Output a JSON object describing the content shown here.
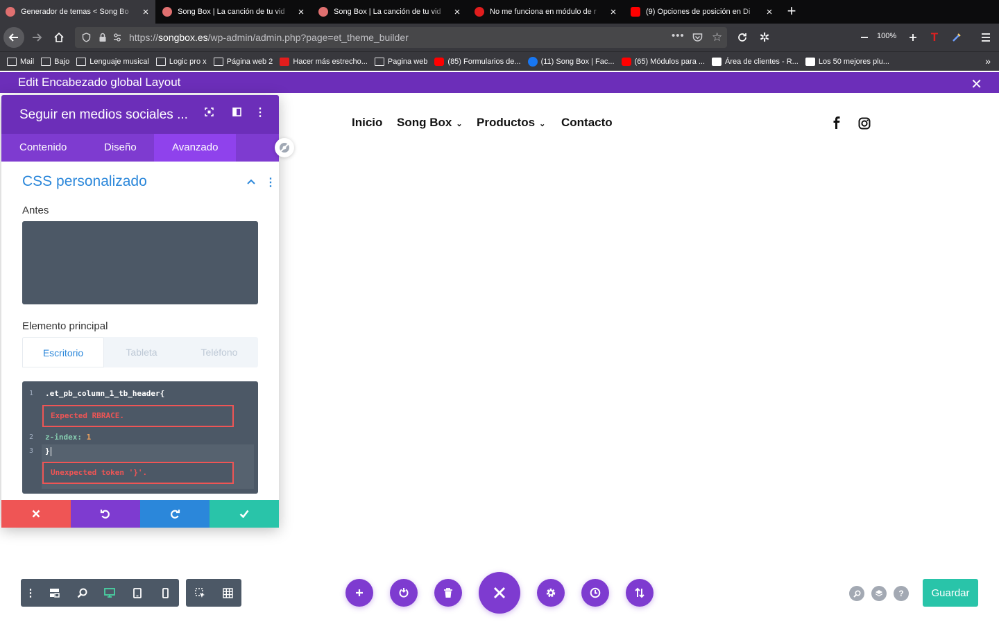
{
  "browser": {
    "tabs": [
      {
        "title": "Generador de temas < Song Bo",
        "active": true,
        "favicon_color": "#e07070"
      },
      {
        "title": "Song Box | La canción de tu vid",
        "active": false,
        "favicon_color": "#e07070"
      },
      {
        "title": "Song Box | La canción de tu vid",
        "active": false,
        "favicon_color": "#e07070"
      },
      {
        "title": "No me funciona en módulo de r",
        "active": false,
        "favicon_color": "#e11d1d"
      },
      {
        "title": "(9) Opciones de posición en Di",
        "active": false,
        "favicon_color": "#ff0000"
      }
    ],
    "new_tab_label": "+",
    "url_prefix": "https://",
    "url_host": "songbox.es",
    "url_path": "/wp-admin/admin.php?page=et_theme_builder",
    "zoom": "100%",
    "bookmarks": [
      {
        "label": "Mail",
        "icon": "folder-icon"
      },
      {
        "label": "Bajo",
        "icon": "folder-icon"
      },
      {
        "label": "Lenguaje musical",
        "icon": "folder-icon"
      },
      {
        "label": "Logic pro x",
        "icon": "folder-icon"
      },
      {
        "label": "Página web 2",
        "icon": "folder-icon"
      },
      {
        "label": "Hacer más estrecho...",
        "icon": "wu-icon"
      },
      {
        "label": "Pagina web",
        "icon": "folder-icon"
      },
      {
        "label": "(85) Formularios de...",
        "icon": "youtube-icon"
      },
      {
        "label": "(11) Song Box | Fac...",
        "icon": "facebook-icon"
      },
      {
        "label": "(65) Módulos para ...",
        "icon": "youtube-icon"
      },
      {
        "label": "Área de clientes - R...",
        "icon": "divi-icon"
      },
      {
        "label": "Los 50 mejores plu...",
        "icon": "wordpress-icon"
      }
    ]
  },
  "editbar": {
    "title": "Edit Encabezado global Layout",
    "close": "✕"
  },
  "site": {
    "menu": [
      {
        "label": "Inicio",
        "dropdown": false
      },
      {
        "label": "Song Box",
        "dropdown": true
      },
      {
        "label": "Productos",
        "dropdown": true
      },
      {
        "label": "Contacto",
        "dropdown": false
      }
    ],
    "social": [
      "facebook-icon",
      "instagram-icon"
    ]
  },
  "panel": {
    "title": "Seguir en medios sociales ...",
    "tabs": [
      "Contenido",
      "Diseño",
      "Avanzado"
    ],
    "active_tab": "Avanzado",
    "section_title": "CSS personalizado",
    "before_label": "Antes",
    "main_label": "Elemento principal",
    "device_tabs": [
      "Escritorio",
      "Tableta",
      "Teléfono"
    ],
    "active_device": "Escritorio",
    "code": {
      "line_numbers": [
        "1",
        "2",
        "3"
      ],
      "line1": ".et_pb_column_1_tb_header{",
      "error1": "Expected RBRACE.",
      "line2_prop": "z-index:",
      "line2_value": "1",
      "line3": "}",
      "error2": "Unexpected token '}'."
    },
    "footer_colors": {
      "cancel": "#ef5555",
      "undo": "#7e3bd0",
      "redo": "#2b87da",
      "save": "#29c4a9"
    }
  },
  "bottom": {
    "left_tools": [
      "more-icon",
      "wireframe-icon",
      "zoom-icon",
      "desktop-icon",
      "tablet-icon",
      "phone-icon"
    ],
    "right_tools": [
      "select-icon",
      "grid-icon"
    ],
    "center_buttons": [
      "add-icon",
      "power-icon",
      "trash-icon",
      "close-icon",
      "gear-icon",
      "history-icon",
      "sort-icon"
    ],
    "mini_buttons": [
      "search-icon",
      "layers-icon",
      "help-icon"
    ],
    "save_label": "Guardar"
  }
}
